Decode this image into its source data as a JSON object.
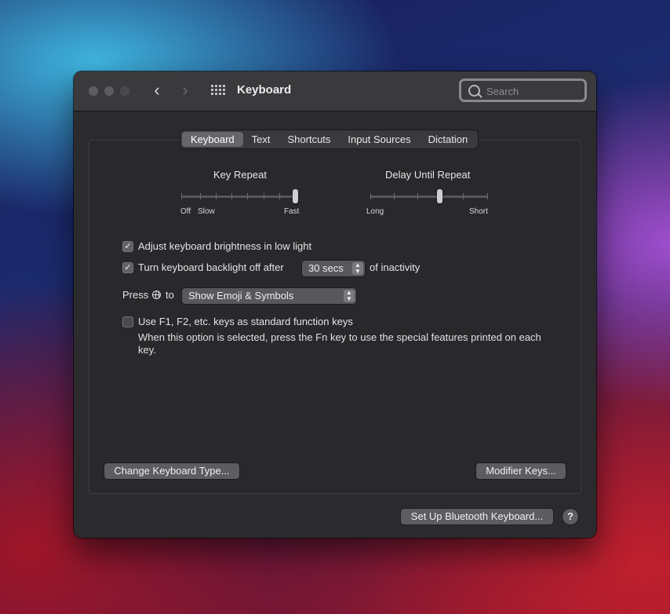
{
  "window": {
    "title": "Keyboard"
  },
  "search": {
    "placeholder": "Search"
  },
  "tabs": [
    {
      "label": "Keyboard",
      "active": true
    },
    {
      "label": "Text",
      "active": false
    },
    {
      "label": "Shortcuts",
      "active": false
    },
    {
      "label": "Input Sources",
      "active": false
    },
    {
      "label": "Dictation",
      "active": false
    }
  ],
  "key_repeat": {
    "title": "Key Repeat",
    "labels": {
      "off": "Off",
      "slow": "Slow",
      "fast": "Fast"
    },
    "level": 1.0
  },
  "delay_until_repeat": {
    "title": "Delay Until Repeat",
    "labels": {
      "long": "Long",
      "short": "Short"
    },
    "level": 0.6
  },
  "options": {
    "brightness": {
      "label": "Adjust keyboard brightness in low light",
      "checked": true
    },
    "backlight": {
      "label": "Turn keyboard backlight off after",
      "value": "30 secs",
      "suffix": "of inactivity",
      "checked": true
    },
    "press_globe": {
      "prefix": "Press",
      "to": "to",
      "value": "Show Emoji & Symbols"
    },
    "fn_keys": {
      "label": "Use F1, F2, etc. keys as standard function keys",
      "description": "When this option is selected, press the Fn key to use the special features printed on each key.",
      "checked": false
    }
  },
  "buttons": {
    "change_type": "Change Keyboard Type...",
    "modifier_keys": "Modifier Keys...",
    "bluetooth": "Set Up Bluetooth Keyboard...",
    "help": "?"
  },
  "icons": {
    "back": "chevron-left-icon",
    "forward": "chevron-right-icon",
    "grid": "grid-icon",
    "search": "search-icon",
    "globe": "globe-icon"
  },
  "colors": {
    "window_bg": "#2b2a2d",
    "titlebar_bg": "#3a393c",
    "active_tab": "#67666a"
  }
}
